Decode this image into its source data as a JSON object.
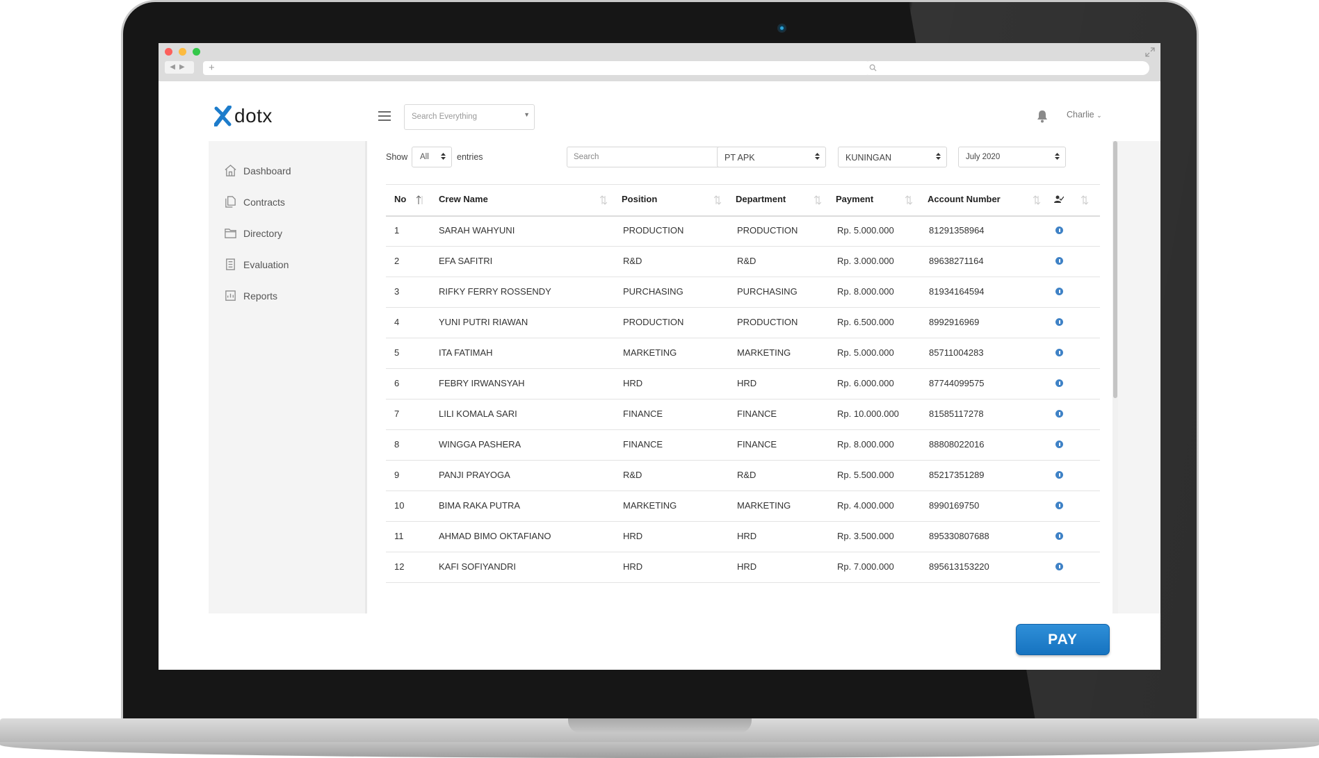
{
  "browser": {
    "new_tab_symbol": "+"
  },
  "app": {
    "logo_text": "dotx",
    "search_placeholder": "Search Everything",
    "user_name": "Charlie"
  },
  "sidebar": {
    "items": [
      {
        "label": "Dashboard",
        "icon": "home-icon"
      },
      {
        "label": "Contracts",
        "icon": "documents-icon"
      },
      {
        "label": "Directory",
        "icon": "folder-icon"
      },
      {
        "label": "Evaluation",
        "icon": "checklist-icon"
      },
      {
        "label": "Reports",
        "icon": "report-icon"
      }
    ]
  },
  "controls": {
    "show_label": "Show",
    "show_value": "All",
    "entries_label": "entries",
    "search_placeholder": "Search",
    "company": "PT APK",
    "location": "KUNINGAN",
    "period": "July 2020"
  },
  "table": {
    "headers": [
      "No",
      "Crew Name",
      "Position",
      "Department",
      "Payment",
      "Account Number",
      "user-check-icon"
    ],
    "rows": [
      [
        "1",
        "SARAH WAHYUNI",
        "PRODUCTION",
        "PRODUCTION",
        "Rp. 5.000.000",
        "81291358964"
      ],
      [
        "2",
        "EFA SAFITRI",
        "R&D",
        "R&D",
        "Rp. 3.000.000",
        "89638271164"
      ],
      [
        "3",
        "RIFKY FERRY ROSSENDY",
        "PURCHASING",
        "PURCHASING",
        "Rp. 8.000.000",
        "81934164594"
      ],
      [
        "4",
        "YUNI PUTRI RIAWAN",
        "PRODUCTION",
        "PRODUCTION",
        "Rp. 6.500.000",
        "8992916969"
      ],
      [
        "5",
        "ITA FATIMAH",
        "MARKETING",
        "MARKETING",
        "Rp. 5.000.000",
        "85711004283"
      ],
      [
        "6",
        "FEBRY IRWANSYAH",
        "HRD",
        "HRD",
        "Rp. 6.000.000",
        "87744099575"
      ],
      [
        "7",
        "LILI KOMALA SARI",
        "FINANCE",
        "FINANCE",
        "Rp. 10.000.000",
        "81585117278"
      ],
      [
        "8",
        "WINGGA PASHERA",
        "FINANCE",
        "FINANCE",
        "Rp. 8.000.000",
        "88808022016"
      ],
      [
        "9",
        "PANJI PRAYOGA",
        "R&D",
        "R&D",
        "Rp. 5.500.000",
        "85217351289"
      ],
      [
        "10",
        "BIMA RAKA PUTRA",
        "MARKETING",
        "MARKETING",
        "Rp. 4.000.000",
        "8990169750"
      ],
      [
        "11",
        "AHMAD BIMO OKTAFIANO",
        "HRD",
        "HRD",
        "Rp. 3.500.000",
        "895330807688"
      ],
      [
        "12",
        "KAFI SOFIYANDRI",
        "HRD",
        "HRD",
        "Rp. 7.000.000",
        "895613153220"
      ]
    ]
  },
  "actions": {
    "pay_label": "PAY"
  },
  "colors": {
    "accent": "#1d7ccb",
    "info_dot": "#3f82c6",
    "sidebar_bg": "#f4f4f4"
  }
}
